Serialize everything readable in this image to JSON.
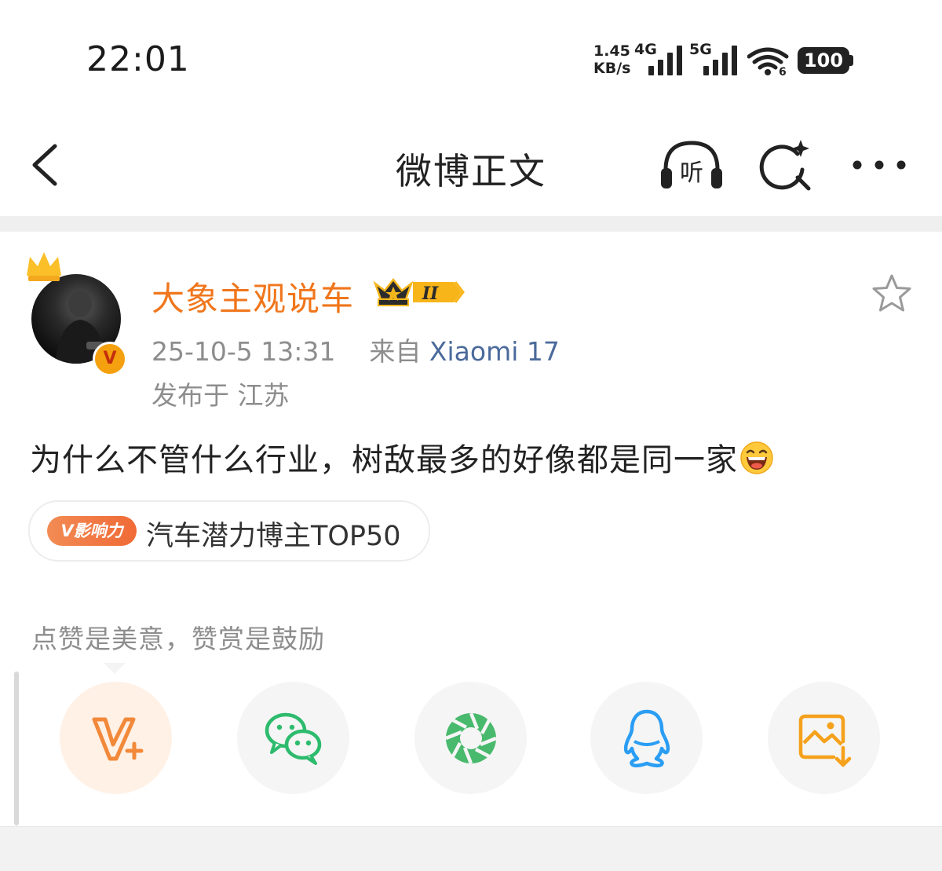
{
  "status_bar": {
    "time": "22:01",
    "net_speed_value": "1.45",
    "net_speed_unit": "KB/s",
    "net_type_1": "4G",
    "net_type_2": "5G",
    "wifi_badge": "6",
    "battery": "100"
  },
  "nav": {
    "title": "微博正文",
    "listen_label": "听",
    "icons": [
      "back-icon",
      "listen-icon",
      "search-sparkle-icon",
      "more-icon"
    ]
  },
  "post": {
    "username": "大象主观说车",
    "verified_badge": "V",
    "level_badge": "II",
    "date_time": "25-10-5 13:31",
    "source_prefix": "来自",
    "source_device": "Xiaomi 17",
    "location": "发布于 江苏",
    "content": "为什么不管什么行业，树敌最多的好像都是同一家",
    "tag": {
      "badge": "V影响力",
      "text": "汽车潜力博主TOP50"
    }
  },
  "reward": {
    "text": "点赞是美意，赞赏是鼓励"
  },
  "share": {
    "buttons": [
      "vplus-icon",
      "wechat-icon",
      "moments-icon",
      "qq-icon",
      "save-image-icon"
    ]
  },
  "colors": {
    "username": "#f0761c",
    "device": "#4b6a9b",
    "meta": "#8d8d8d",
    "tag_badge": "#f06a36",
    "wechat": "#2dbb6d",
    "qq": "#2a9df4",
    "save": "#f5a11b"
  }
}
